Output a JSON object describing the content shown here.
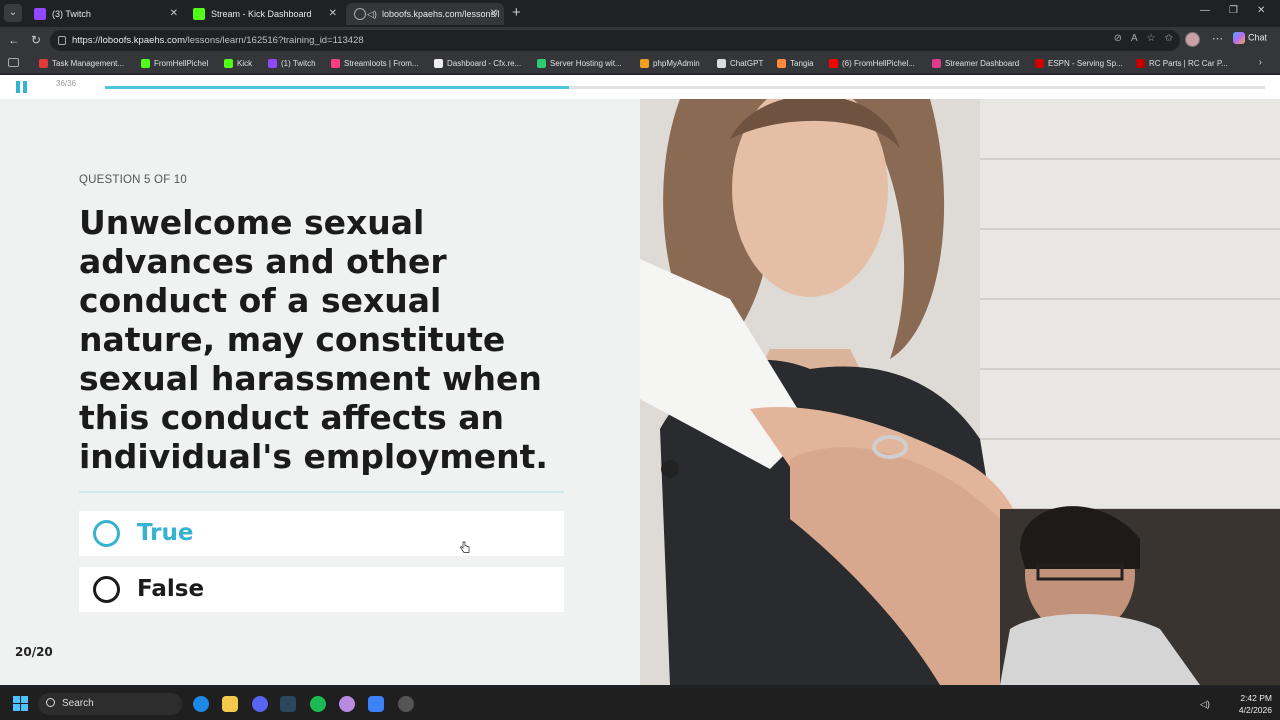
{
  "browser": {
    "tabs": [
      {
        "title": "(3) Twitch",
        "favicon_color": "#9146ff"
      },
      {
        "title": "Stream - Kick Dashboard",
        "favicon_color": "#53fc18"
      },
      {
        "title": "loboofs.kpaehs.com/lessons/l",
        "favicon_color": "#9aa0a6"
      }
    ],
    "url_host": "https://loboofs.kpaehs.com",
    "url_path": "/lessons/learn/162516?training_id=113428",
    "chat_label": "Chat",
    "bookmarks": [
      {
        "label": "Task Management...",
        "color": "#e03a3a"
      },
      {
        "label": "FromHellPichel",
        "color": "#53fc18"
      },
      {
        "label": "Kick",
        "color": "#53fc18"
      },
      {
        "label": "(1) Twitch",
        "color": "#9146ff"
      },
      {
        "label": "Streamloots | From...",
        "color": "#ff3d7f"
      },
      {
        "label": "Dashboard - Cfx.re...",
        "color": "#eeeeee"
      },
      {
        "label": "Server Hosting wit...",
        "color": "#2ecc71"
      },
      {
        "label": "phpMyAdmin",
        "color": "#f0a020"
      },
      {
        "label": "ChatGPT",
        "color": "#dddddd"
      },
      {
        "label": "Tangia",
        "color": "#ff8a3d"
      },
      {
        "label": "(6) FromHellPichel...",
        "color": "#ff0000"
      },
      {
        "label": "Streamer Dashboard",
        "color": "#e03a8a"
      },
      {
        "label": "ESPN - Serving Sp...",
        "color": "#d00000"
      },
      {
        "label": "RC Parts | RC Car P...",
        "color": "#c00000"
      }
    ]
  },
  "player": {
    "slide_counter": "36/36",
    "progress": 0.4,
    "accent_color": "#35b3d0"
  },
  "quiz": {
    "question_number": "QUESTION 5 OF 10",
    "question_text": "Unwelcome sexual advances and other conduct of a sexual nature, may constitute sexual harassment when this conduct affects an individual's employment.",
    "options": [
      {
        "label": "True",
        "hovered": true
      },
      {
        "label": "False",
        "hovered": false
      }
    ],
    "brand": "20/20"
  },
  "taskbar": {
    "search_label": "Search",
    "time": "2:42 PM",
    "date": "4/2/2026"
  }
}
